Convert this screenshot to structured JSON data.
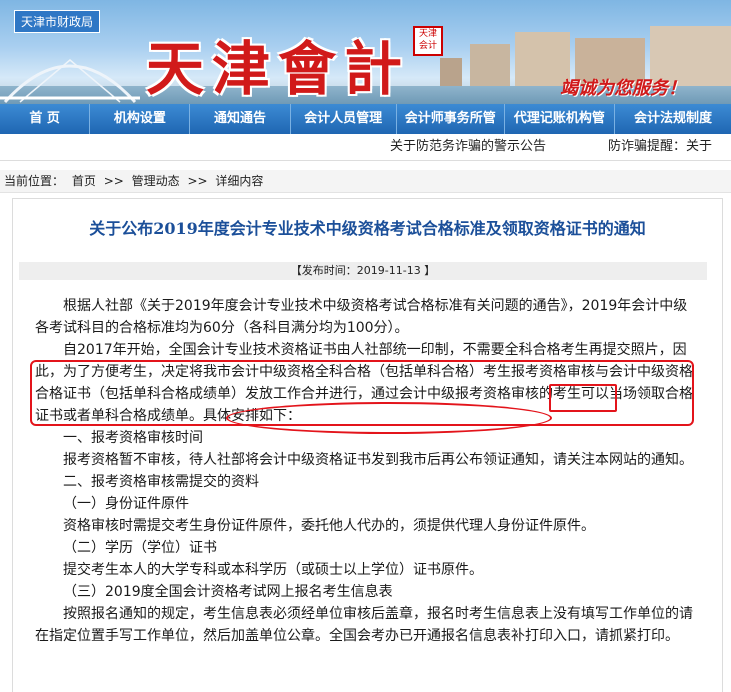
{
  "site": {
    "bureau": "天津市财政局",
    "title": "天津會計",
    "seal": "天津会计",
    "slogan": "竭诚为您服务！"
  },
  "nav": {
    "items": [
      "首  页",
      "机构设置",
      "通知通告",
      "会计人员管理",
      "会计师事务所管",
      "代理记账机构管",
      "会计法规制度"
    ]
  },
  "ticker": {
    "item1": "关于防范​务诈骗的警示公告",
    "item2": "防诈骗提醒：关于"
  },
  "breadcrumb": {
    "label": "当前位置：",
    "items": [
      "首页",
      ">>",
      "管理动态",
      ">>",
      "详细内容"
    ]
  },
  "article": {
    "title": "关于公布2019年度会计专业技术中级资格考试合格标准及领取资格证书的通知",
    "publish": "【发布时间：2019-11-13 】",
    "paragraphs": [
      "根据人社部《关于2019年度会计专业技术中级资格考试合格标准有关问题的通告》，2019年会计中级各考试科目的合格标准均为60分（各科目满分均为100分）。",
      "自2017年开始，全国会计专业技术资格证书由人社部统一印制，不需要全科合格考生再提交照片，因此，为了方便考生，决定将我市会计中级资格全科合格（包括单科合格）考生报考资格审核与会计中级资格合格证书（包括单科合格成绩单）发放工作合并进行，通过会计中级报考资格审核的考生可以当场领取合格证书或者单科合格成绩单。具体安排如下：",
      "一、报考资格审核时间",
      "报考资格暂不审核，待人社部将会计中级资格证书发到我市后再公布领证通知，请关注本网站的通知。",
      "二、报考资格审核需提交的资料",
      "（一）身份证件原件",
      "资格审核时需提交考生身份证件原件，委托他人代办的，须提供代理人身份证件原件。",
      "（二）学历（学位）证书",
      "提交考生本人的大学专科或本科学历（或硕士以上学位）证书原件。",
      "（三）2019度全国会计资格考试网上报名考生信息表",
      "按照报名通知的规定，考生信息表必须经单位审核后盖章，报名时考生信息表上没有填写工作单位的请在指定位置手写工作单位，然后加盖单位公章。全国会考办已开通报名信息表补打印入口，请抓紧打印。"
    ]
  },
  "colors": {
    "nav_bg": "#2a74c0",
    "title_blue": "#1b4f99",
    "annotation_red": "#e3141b",
    "logo_red": "#d11a1a"
  }
}
